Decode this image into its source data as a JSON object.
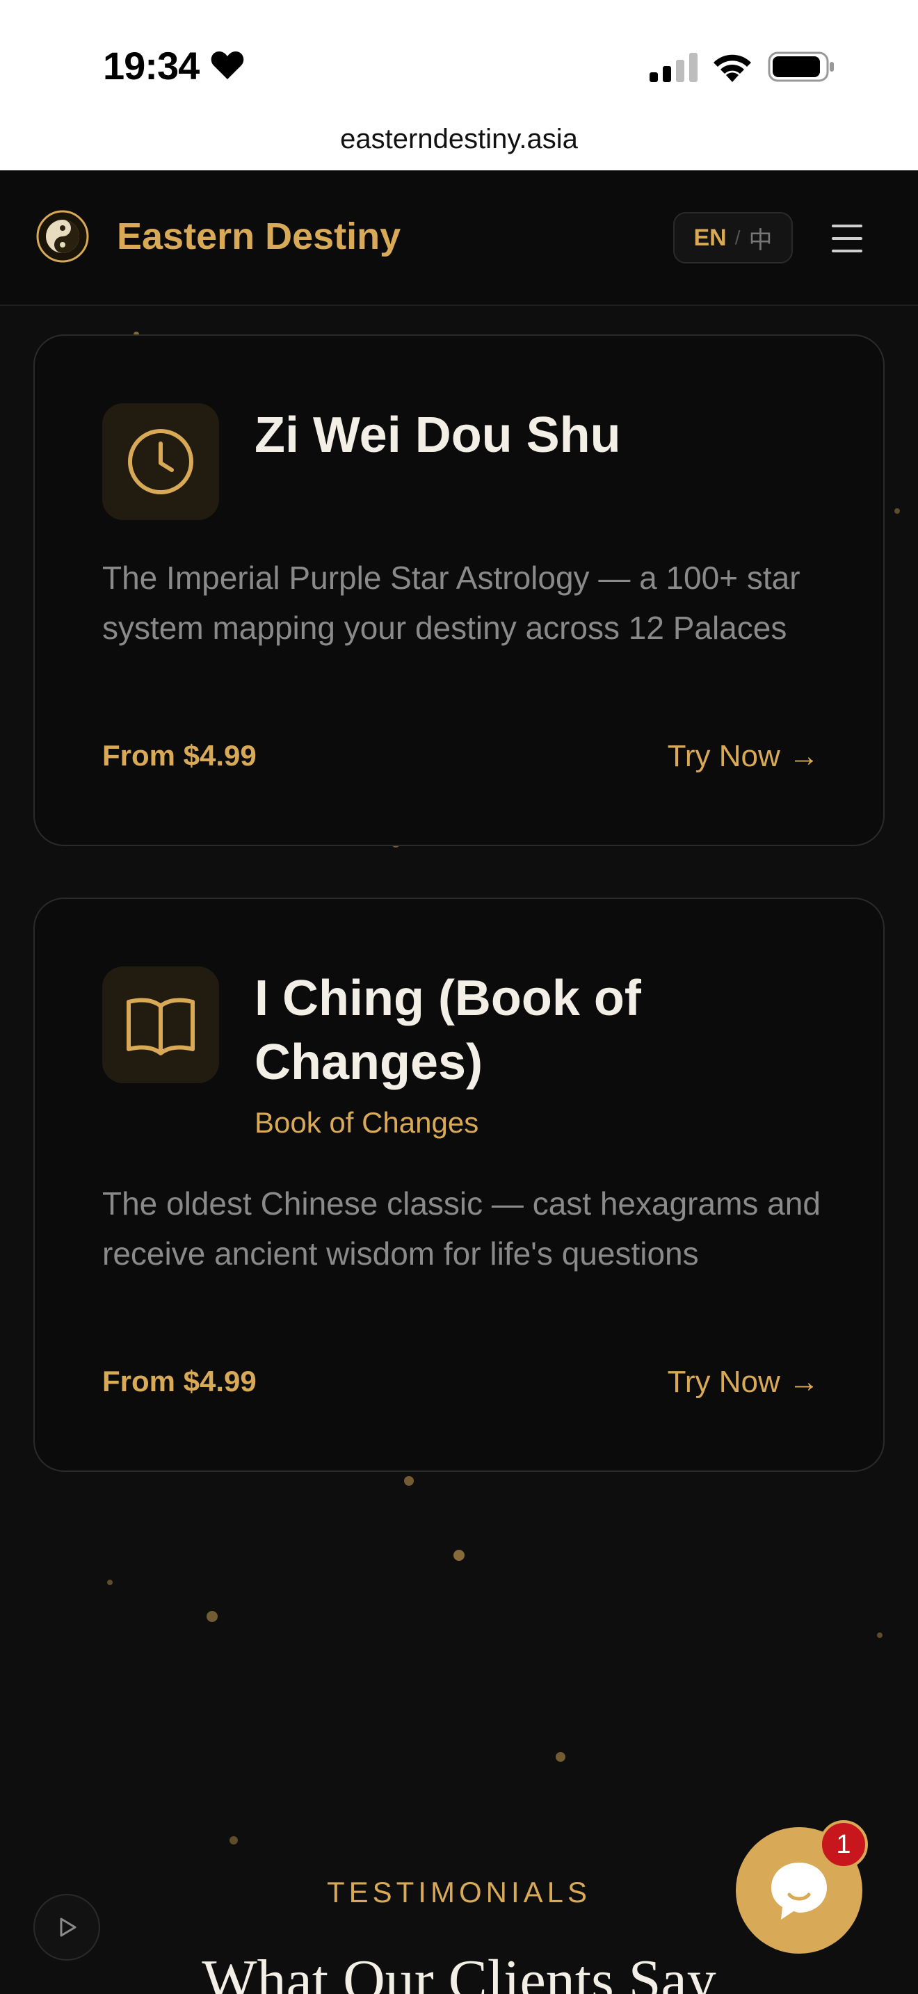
{
  "status_bar": {
    "time": "19:34",
    "url": "easterndestiny.asia"
  },
  "header": {
    "brand": "Eastern Destiny",
    "lang_en": "EN",
    "lang_sep": "/",
    "lang_zh": "中"
  },
  "cards": [
    {
      "icon": "clock-icon",
      "title": "Zi Wei Dou Shu",
      "description": "The Imperial Purple Star Astrology — a 100+ star system mapping your destiny across 12 Palaces",
      "price": "From $4.99",
      "cta": "Try Now →"
    },
    {
      "icon": "book-icon",
      "title": "I Ching (Book of Changes)",
      "subtitle": "Book of Changes",
      "description": "The oldest Chinese classic — cast hexagrams and receive ancient wisdom for life's questions",
      "price": "From $4.99",
      "cta": "Try Now →"
    }
  ],
  "testimonials": {
    "eyebrow": "TESTIMONIALS",
    "heading": "What Our Clients Say"
  },
  "chat_widget": {
    "badge_count": "1"
  },
  "colors": {
    "accent": "#d8a957",
    "background": "#0e0e0e",
    "badge": "#c8161d"
  }
}
